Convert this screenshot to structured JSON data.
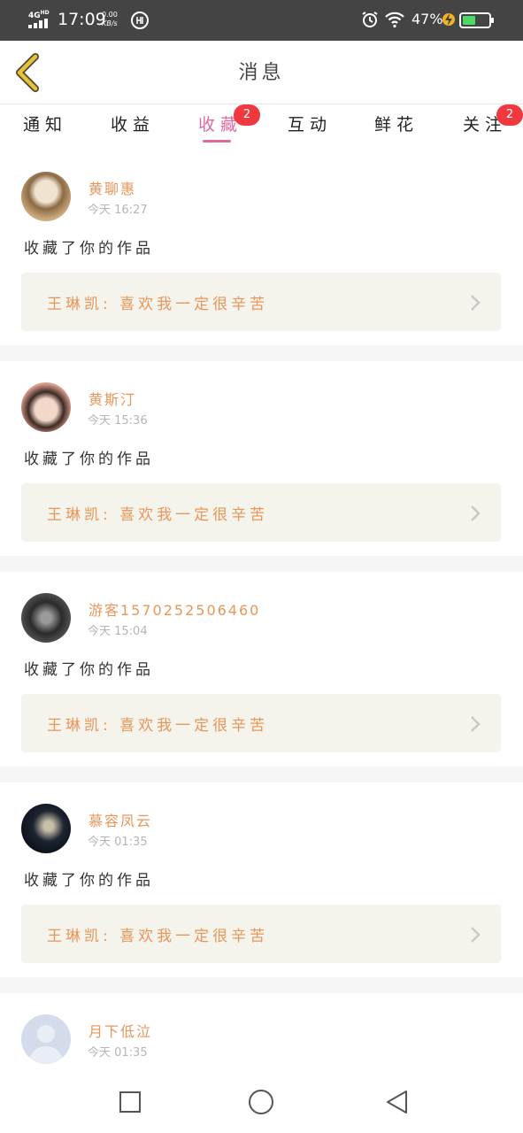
{
  "status_bar": {
    "network": "4G",
    "network_sup": "HD",
    "time": "17:09",
    "speed_value": "0.00",
    "speed_unit": "KB/s",
    "battery_pct": "47%",
    "battery_level": 0.47,
    "icons": [
      "signal-icon",
      "hd-icon",
      "alarm-icon",
      "wifi-icon",
      "charging-icon",
      "battery-icon"
    ]
  },
  "header": {
    "title": "消息",
    "back_icon": "chevron-left-icon",
    "accent": "#e8c13a"
  },
  "tabs": [
    {
      "label": "通知",
      "active": false
    },
    {
      "label": "收益",
      "active": false
    },
    {
      "label": "收藏",
      "active": true,
      "badge": "2"
    },
    {
      "label": "互动",
      "active": false
    },
    {
      "label": "鲜花",
      "active": false
    },
    {
      "label": "关注",
      "active": false,
      "badge": "2"
    }
  ],
  "colors": {
    "tab_active": "#e06aa0",
    "name": "#e8965a",
    "badge": "#f0383f",
    "work_box_bg": "#f4f4ec"
  },
  "items": [
    {
      "name": "黄聊惠",
      "time": "今天 16:27",
      "action": "收藏了你的作品",
      "work": "王琳凯: 喜欢我一定很辛苦"
    },
    {
      "name": "黄斯汀",
      "time": "今天 15:36",
      "action": "收藏了你的作品",
      "work": "王琳凯: 喜欢我一定很辛苦"
    },
    {
      "name": "游客1570252506460",
      "time": "今天 15:04",
      "action": "收藏了你的作品",
      "work": "王琳凯: 喜欢我一定很辛苦"
    },
    {
      "name": "慕容凤云",
      "time": "今天 01:35",
      "action": "收藏了你的作品",
      "work": "王琳凯: 喜欢我一定很辛苦"
    },
    {
      "name": "月下低泣",
      "time": "今天 01:35"
    }
  ],
  "nav_bar": [
    "recent-apps-icon",
    "home-icon",
    "back-triangle-icon"
  ]
}
